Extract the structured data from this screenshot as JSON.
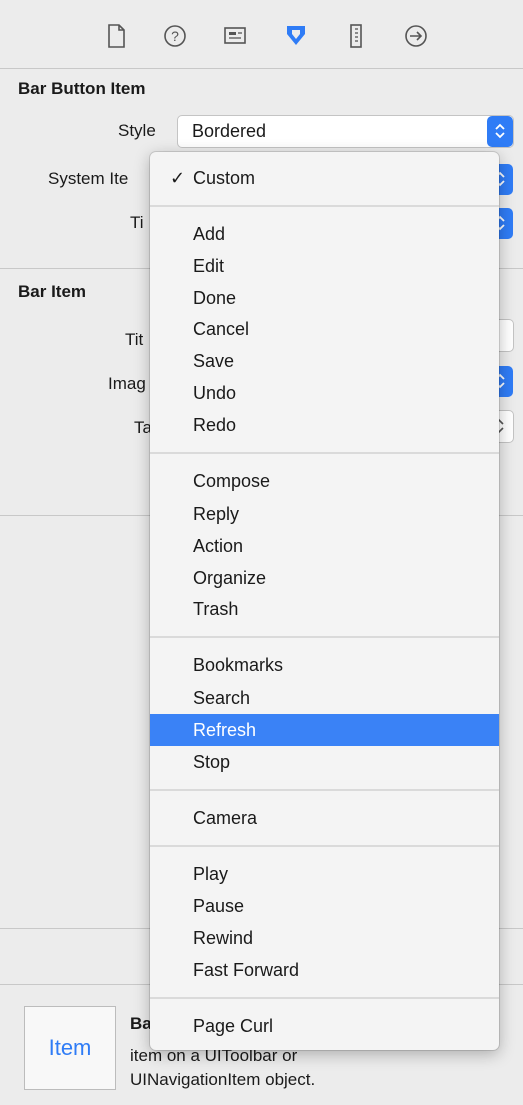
{
  "toolbar": {
    "icons": [
      "file-inspector-icon",
      "quick-help-icon",
      "identity-inspector-icon",
      "attributes-inspector-icon",
      "size-inspector-icon",
      "connections-inspector-icon"
    ]
  },
  "bar_button_item": {
    "title": "Bar Button Item",
    "style_label": "Style",
    "style_value": "Bordered",
    "system_item_label": "System Ite",
    "tint_label": "Ti"
  },
  "bar_item": {
    "title": "Bar Item",
    "title_label": "Tit",
    "image_label": "Imag",
    "tag_label": "Ta"
  },
  "menu": {
    "checked": "Custom",
    "group1": [
      "Add",
      "Edit",
      "Done",
      "Cancel",
      "Save",
      "Undo",
      "Redo"
    ],
    "group2": [
      "Compose",
      "Reply",
      "Action",
      "Organize",
      "Trash"
    ],
    "group3": [
      "Bookmarks",
      "Search",
      "Refresh",
      "Stop"
    ],
    "group4": [
      "Camera"
    ],
    "group5": [
      "Play",
      "Pause",
      "Rewind",
      "Fast Forward"
    ],
    "group6": [
      "Page Curl"
    ],
    "highlighted": "Refresh"
  },
  "description": {
    "icon_label": "Item",
    "title": "Ba",
    "line1": "item on a UIToolbar or",
    "line2": "UINavigationItem object."
  },
  "colors": {
    "accent": "#2f7cf6",
    "highlight": "#3a82f6"
  }
}
